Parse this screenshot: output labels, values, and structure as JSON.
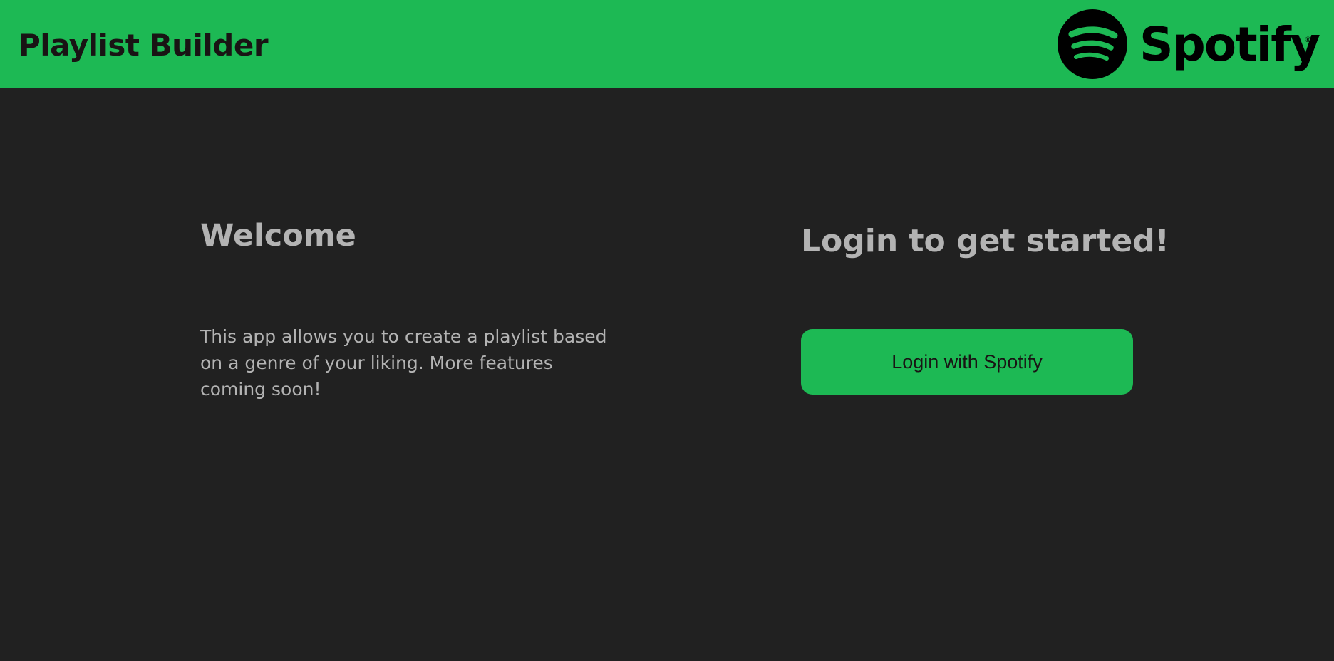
{
  "header": {
    "title": "Playlist Builder",
    "logo": {
      "icon": "spotify-icon",
      "wordmark": "Spotify",
      "registered_mark": "®"
    }
  },
  "welcome": {
    "heading": "Welcome",
    "description": "This app allows you to create a playlist based on a genre of your liking. More features coming soon!"
  },
  "login": {
    "heading": "Login to get started!",
    "button_label": "Login with Spotify"
  },
  "colors": {
    "brand_green": "#1db954",
    "background": "#212121",
    "text_muted": "#b3b3b3",
    "text_dark": "#191414"
  }
}
